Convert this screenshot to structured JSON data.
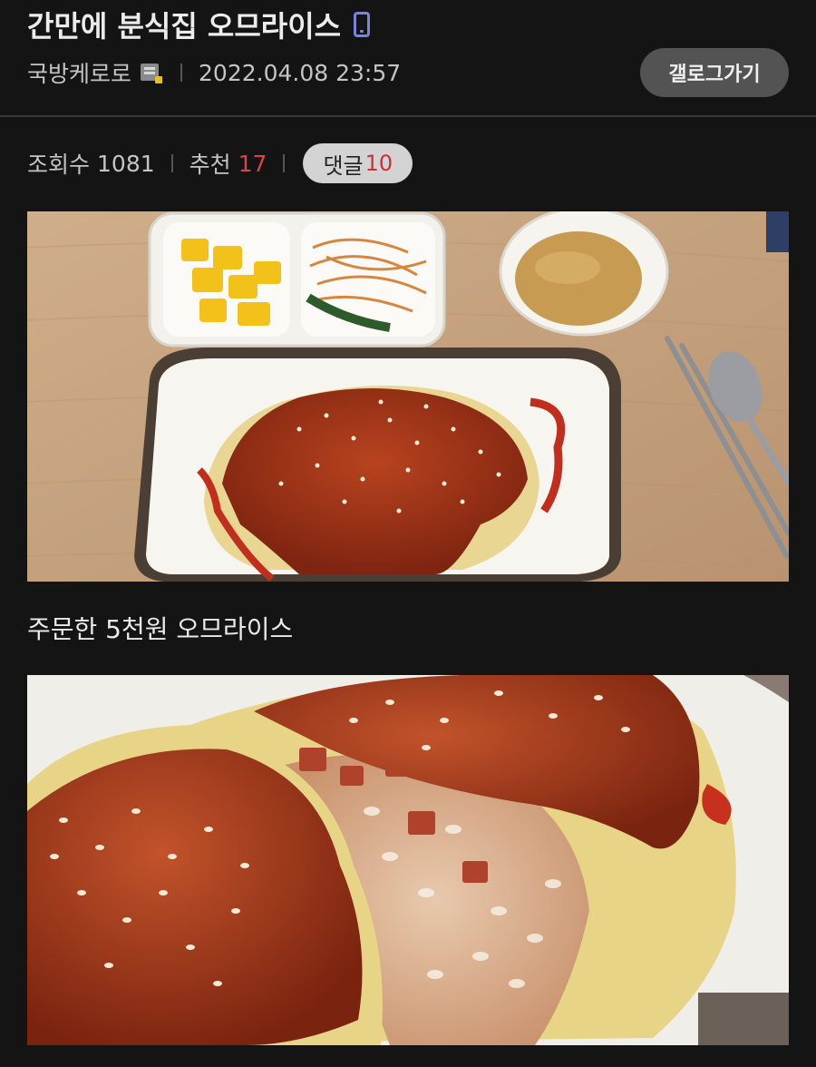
{
  "post": {
    "title": "간만에 분식집 오므라이스",
    "author": "국방케로로",
    "datetime": "2022.04.08 23:57",
    "gallery_button": "갤로그가기",
    "device_icon": "mobile-icon",
    "author_badge_icon": "fixed-nick-icon"
  },
  "stats": {
    "views_label": "조회수",
    "views": "1081",
    "likes_label": "추천",
    "likes": "17",
    "comments_label": "댓글",
    "comments": "10"
  },
  "body": {
    "caption": "주문한 5천원 오므라이스"
  },
  "colors": {
    "background": "#141414",
    "accent_red": "#d9434a",
    "button_gray": "#535353",
    "pill_gray": "#d3d3d3",
    "mobile_icon": "#7c83d8"
  }
}
